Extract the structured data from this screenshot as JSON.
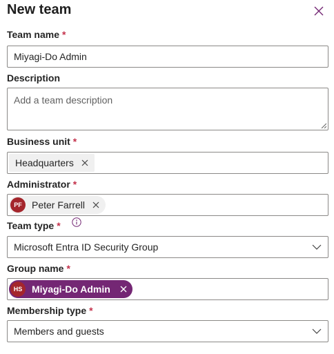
{
  "panel": {
    "title": "New team"
  },
  "form": {
    "team_name": {
      "label": "Team name",
      "required": "*",
      "value": "Miyagi-Do Admin"
    },
    "description": {
      "label": "Description",
      "placeholder": "Add a team description"
    },
    "business_unit": {
      "label": "Business unit",
      "required": "*",
      "chip": "Headquarters"
    },
    "administrator": {
      "label": "Administrator",
      "required": "*",
      "chip": "Peter Farrell",
      "initials": "PF"
    },
    "team_type": {
      "label": "Team type",
      "required": "*",
      "value": "Microsoft Entra ID Security Group",
      "info_icon": "info-icon"
    },
    "group_name": {
      "label": "Group name",
      "required": "*",
      "chip": "Miyagi-Do Admin",
      "initials": "HS"
    },
    "membership_type": {
      "label": "Membership type",
      "required": "*",
      "value": "Members and guests"
    }
  },
  "colors": {
    "accent": "#742774",
    "required": "#c4314b",
    "avatar": "#a4262c",
    "border": "#8a8886"
  }
}
